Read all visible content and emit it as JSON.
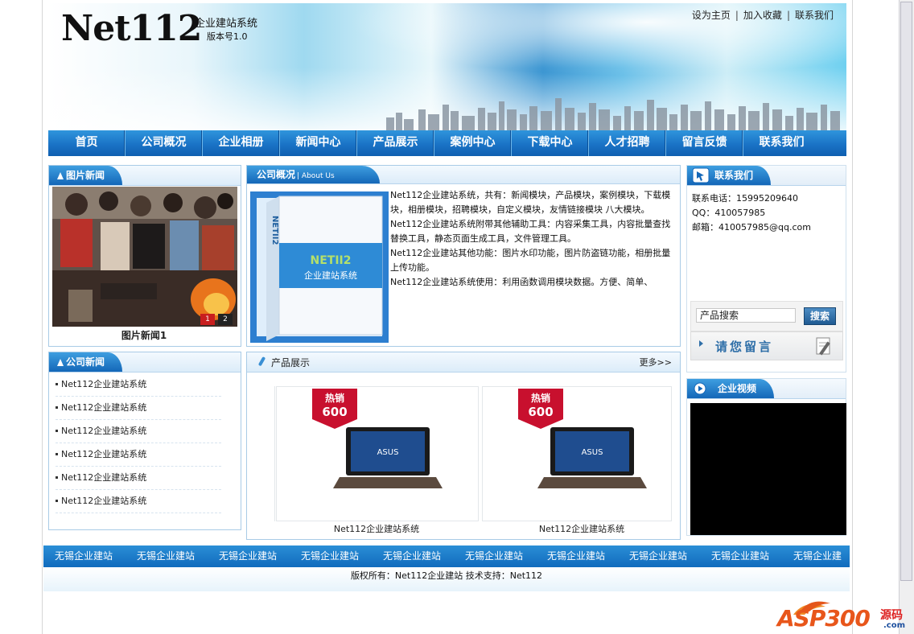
{
  "header": {
    "logo": "Net112",
    "site_name": "企业建站系统",
    "version": "版本号1.0",
    "top_links": [
      "设为主页",
      "加入收藏",
      "联系我们"
    ]
  },
  "nav": [
    "首页",
    "公司概况",
    "企业相册",
    "新闻中心",
    "产品展示",
    "案例中心",
    "下载中心",
    "人才招聘",
    "留言反馈",
    "联系我们"
  ],
  "photo_news": {
    "title": "图片新闻",
    "caption": "图片新闻1",
    "slide_buttons": [
      "1",
      "2"
    ]
  },
  "company_news": {
    "title": "公司新闻",
    "items": [
      "Net112企业建站系统",
      "Net112企业建站系统",
      "Net112企业建站系统",
      "Net112企业建站系统",
      "Net112企业建站系统",
      "Net112企业建站系统"
    ]
  },
  "about": {
    "title": "公司概况",
    "subtitle": "| About Us",
    "box_brand": "NETII2",
    "box_text": "企业建站系统",
    "paragraphs": [
      "Net112企业建站系统，共有：新闻模块，产品模块，案例模块，下载模块，相册模块，招聘模块，自定义模块，友情链接模块 八大模块。",
      "Net112企业建站系统附带其他辅助工具：内容采集工具，内容批量查找替换工具，静态页面生成工具，文件管理工具。",
      "Net112企业建站其他功能：图片水印功能，图片防盗链功能，相册批量上传功能。",
      "Net112企业建站系统使用：利用函数调用模块数据。方便、简单、"
    ]
  },
  "products": {
    "title": "产品展示",
    "more": "更多>>",
    "items": [
      {
        "name": "Net112企业建站系统",
        "badge_top": "热销",
        "badge_num": "600",
        "brand": "ASUS"
      },
      {
        "name": "Net112企业建站系统",
        "badge_top": "热销",
        "badge_num": "600",
        "brand": "ASUS"
      }
    ]
  },
  "contact": {
    "title": "联系我们",
    "phone": "联系电话：15995209640",
    "qq": "QQ：410057985",
    "email": "邮箱：410057985@qq.com",
    "search_placeholder": "产品搜索",
    "search_button": "搜索",
    "message_button": "请您留言"
  },
  "video": {
    "title": "企业视频"
  },
  "footer": {
    "links": [
      "无锡企业建站",
      "无锡企业建站",
      "无锡企业建站",
      "无锡企业建站",
      "无锡企业建站",
      "无锡企业建站",
      "无锡企业建站",
      "无锡企业建站",
      "无锡企业建站",
      "无锡企业建"
    ],
    "copyright": "版权所有：Net112企业建站 技术支持：Net112"
  },
  "watermark": {
    "text": "ASP300",
    "src": "源码",
    "com": ".com"
  },
  "colors": {
    "nav_blue": "#1a73c6",
    "panel_border": "#a9cbe6",
    "badge_red": "#c8102e"
  }
}
